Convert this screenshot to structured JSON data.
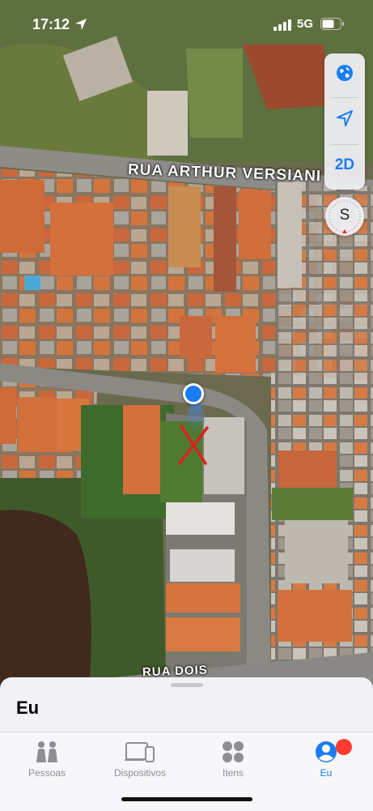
{
  "status_bar": {
    "time": "17:12",
    "network": "5G",
    "icons": [
      "location-arrow-icon",
      "signal-icon",
      "battery-icon"
    ]
  },
  "map": {
    "street_labels": [
      "RUA ARTHUR VERSIANI",
      "RUA DOIS"
    ],
    "controls": {
      "map_mode_icon": "globe-icon",
      "locate_icon": "location-arrow-icon",
      "view_toggle": "2D",
      "compass_heading": "S"
    },
    "user_marker_color": "#1a7cf5",
    "annotation_color": "#d9231f"
  },
  "sheet": {
    "title": "Eu"
  },
  "tabs": [
    {
      "label": "Pessoas",
      "icon": "people-icon",
      "active": false
    },
    {
      "label": "Dispositivos",
      "icon": "devices-icon",
      "active": false
    },
    {
      "label": "Itens",
      "icon": "items-grid-icon",
      "active": false
    },
    {
      "label": "Eu",
      "icon": "person-circle-icon",
      "active": true,
      "badge": true
    }
  ],
  "colors": {
    "accent": "#1a7cf5",
    "badge": "#ff3b30",
    "inactive": "#8e8e93"
  }
}
